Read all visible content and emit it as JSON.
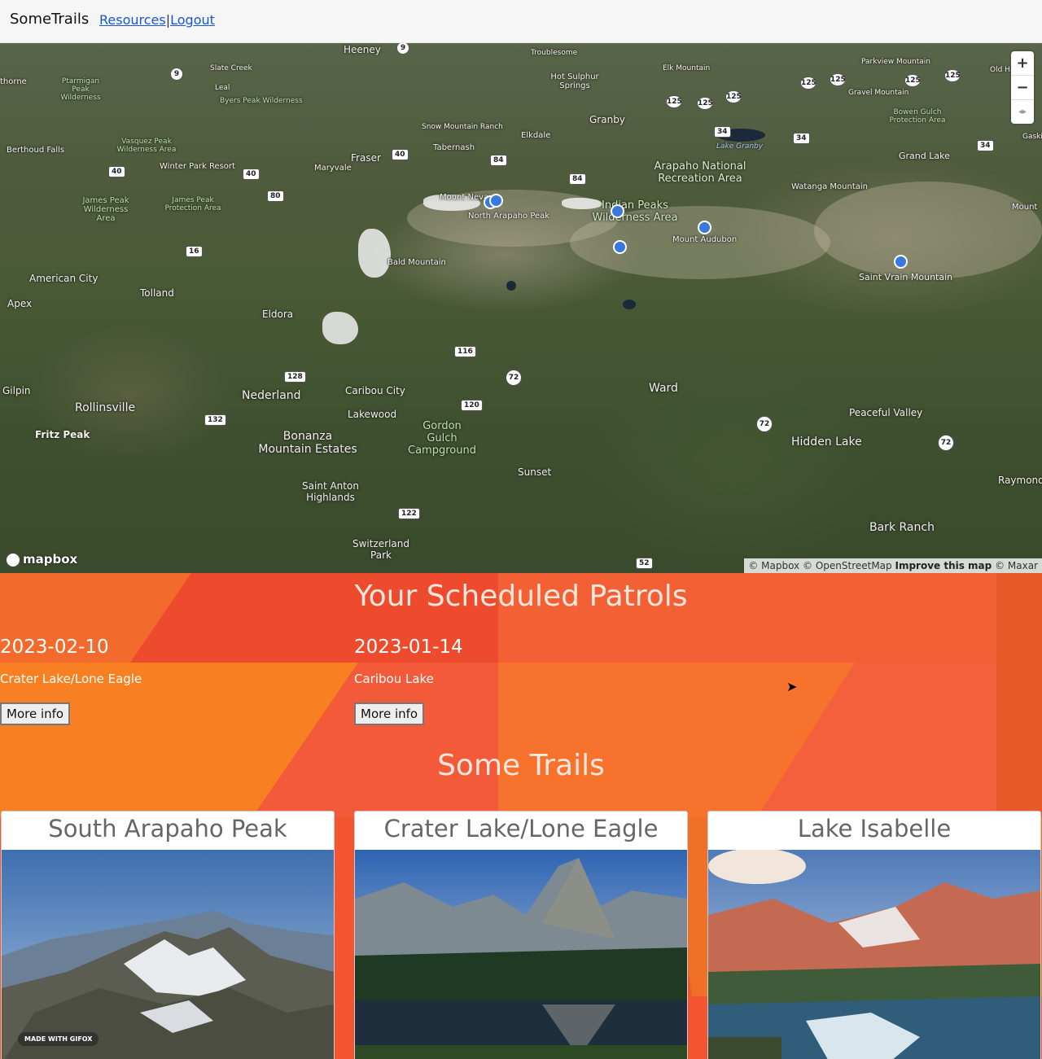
{
  "nav": {
    "brand": "SomeTrails",
    "resources": "Resources",
    "separator": "|",
    "logout": "Logout"
  },
  "map": {
    "places": [
      "Heeney",
      "Troublesome",
      "Hot Sulphur Springs",
      "Elk Mountain",
      "Parkview Mountain",
      "Old Ha",
      "Slate Creek",
      "Ptarmigan Peak Wilderness",
      "Leal",
      "Byers Peak Wilderness",
      "Granby",
      "Gravel Mountain",
      "Bowen Gulch Protection Area",
      "Snow Mountain Ranch",
      "Elkdale",
      "Lake Granby",
      "Vasquez Peak Wilderness Area",
      "Tabernash",
      "Fraser",
      "Berthoud Falls",
      "Winter Park Resort",
      "Maryvale",
      "Grand Lake",
      "Arapaho National Recreation Area",
      "Watanga Mountain",
      "James Peak Wilderness Area",
      "James Peak Protection Area",
      "Mount Neva",
      "North Arapaho Peak",
      "Indian Peaks Wilderness Area",
      "Mount Audubon",
      "Saint Vrain Mountain",
      "Bald Mountain",
      "American City",
      "Tolland",
      "Apex",
      "Eldora",
      "Gilpin",
      "Rollinsville",
      "Nederland",
      "Caribou City",
      "Lakewood",
      "Gordon Gulch Campground",
      "Ward",
      "Peaceful Valley",
      "Fritz Peak",
      "Bonanza Mountain Estates",
      "Hidden Lake",
      "Saint Anton Highlands",
      "Sunset",
      "Raymond",
      "Switzerland Park",
      "Bark Ranch",
      "thorne",
      "Mount",
      "Gaski"
    ],
    "route_shields": [
      "9",
      "40",
      "34",
      "84",
      "125",
      "80",
      "16",
      "116",
      "72",
      "128",
      "120",
      "132",
      "122",
      "52"
    ],
    "zoom_in": "+",
    "zoom_out": "−",
    "compass": "◂▸",
    "logo": "mapbox",
    "attribution": {
      "mapbox": "© Mapbox",
      "osm": "© OpenStreetMap",
      "improve": "Improve this map",
      "maxar": "© Maxar"
    }
  },
  "patrols": {
    "title": "Your Scheduled Patrols",
    "items": [
      {
        "date": "2023-02-10",
        "trail": "Crater Lake/Lone Eagle",
        "button": "More info"
      },
      {
        "date": "2023-01-14",
        "trail": "Caribou Lake",
        "button": "More info"
      }
    ]
  },
  "trails": {
    "title": "Some Trails",
    "cards": [
      {
        "name": "South Arapaho Peak"
      },
      {
        "name": "Crater Lake/Lone Eagle"
      },
      {
        "name": "Lake Isabelle"
      }
    ]
  },
  "watermark": "MADE WITH GIFOX",
  "colors": {
    "accent_orange": "#f0502e",
    "link_blue": "#1a55d6",
    "map_pin": "#3a78de"
  }
}
